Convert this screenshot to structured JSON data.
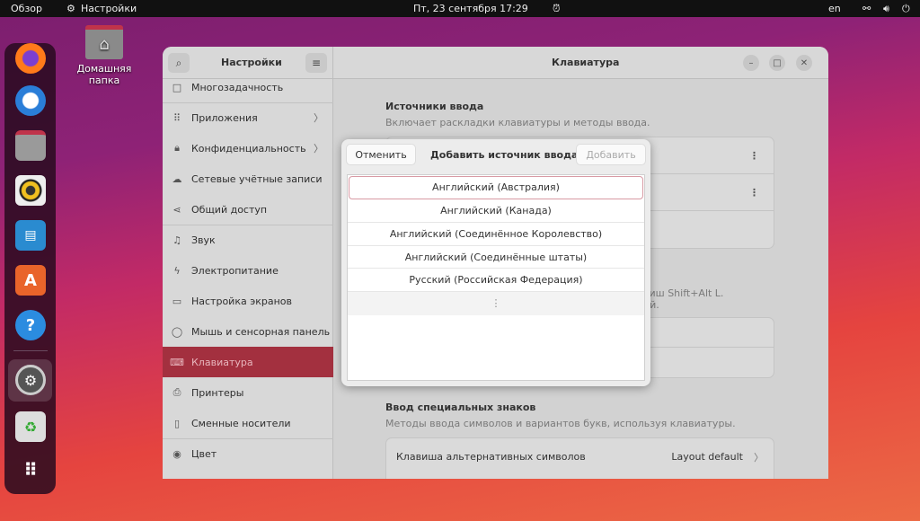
{
  "topbar": {
    "overview": "Обзор",
    "app": "Настройки",
    "datetime": "Пт, 23 сентября  17:29",
    "lang": "en"
  },
  "desktop": {
    "home_folder": "Домашняя папка"
  },
  "window": {
    "sidebar_title": "Настройки",
    "title": "Клавиатура"
  },
  "sidebar": {
    "items": [
      {
        "label": "Многозадачность",
        "icon": "□"
      },
      {
        "label": "Приложения",
        "icon": "⠿",
        "chevron": true
      },
      {
        "label": "Конфиденциальность",
        "icon": "🔒︎",
        "chevron": true
      },
      {
        "label": "Сетевые учётные записи",
        "icon": "☁"
      },
      {
        "label": "Общий доступ",
        "icon": "⋖"
      },
      {
        "label": "Звук",
        "icon": "♫"
      },
      {
        "label": "Электропитание",
        "icon": "ϟ"
      },
      {
        "label": "Настройка экранов",
        "icon": "▭"
      },
      {
        "label": "Мышь и сенсорная панель",
        "icon": "◯"
      },
      {
        "label": "Клавиатура",
        "icon": "⌨",
        "selected": true
      },
      {
        "label": "Принтеры",
        "icon": "⎙"
      },
      {
        "label": "Сменные носители",
        "icon": "▯"
      },
      {
        "label": "Цвет",
        "icon": "◉"
      }
    ]
  },
  "content": {
    "input_sources_title": "Источники ввода",
    "input_sources_desc": "Включает раскладки клавиатуры и методы ввода.",
    "switch_desc_fragment_1": "виш Shift+Alt L.",
    "switch_desc_fragment_2": "ий.",
    "special_title": "Ввод специальных знаков",
    "special_desc": "Методы ввода символов и вариантов букв, используя клавиатуры.",
    "alt_key_label": "Клавиша альтернативных символов",
    "alt_key_value": "Layout default"
  },
  "dialog": {
    "cancel": "Отменить",
    "title": "Добавить источник ввода",
    "add": "Добавить",
    "items": [
      "Английский (Австралия)",
      "Английский (Канада)",
      "Английский (Соединённое Королевство)",
      "Английский (Соединённые штаты)",
      "Русский (Российская Федерация)"
    ],
    "more": "⋮"
  }
}
